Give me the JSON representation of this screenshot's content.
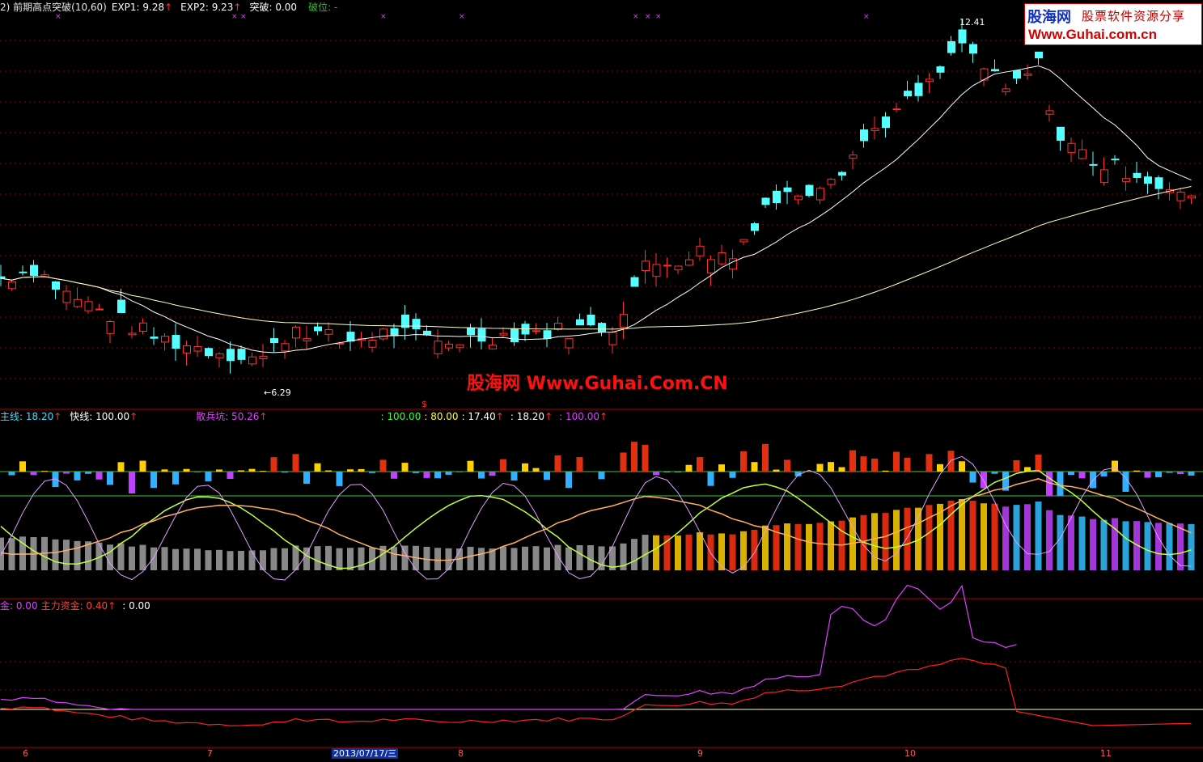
{
  "panel1": {
    "title_prefix": "2) 前期高点突破(10,60)",
    "exp1_label": "EXP1: 9.28",
    "exp2_label": "EXP2: 9.23",
    "breakout_label": "突破: 0.00",
    "break_level_label": "破位: -",
    "high_label": "12.41",
    "low_label": "6.29",
    "signal_marker": "$"
  },
  "panel2": {
    "main_line_label": "主线: 18.20",
    "fast_line_label": "快线: 100.00",
    "retail_pit_label": "散兵坑: 50.26",
    "v1": ": 100.00",
    "v2": ": 80.00",
    "v3": ": 17.40",
    "v4": ": 18.20",
    "v5": ": 100.00"
  },
  "panel3": {
    "gold_label": "金: 0.00",
    "main_fund_label": "主力资金: 0.40",
    "v1": ": 0.00"
  },
  "logo": {
    "name": "股海网",
    "slogan": "股票软件资源分享",
    "url": "Www.Guhai.com.cn"
  },
  "watermark": "股海网 Www.Guhai.Com.CN",
  "x_axis": {
    "months": [
      "6",
      "7",
      "8",
      "9",
      "10",
      "11"
    ],
    "cursor_date": "2013/07/17/三"
  },
  "colors": {
    "background": "#000000",
    "up_candle": "#ff3030",
    "down_candle": "#54ffff",
    "ma_short": "#ffffff",
    "ma_long": "#ffffc0",
    "grid": "#8b0000",
    "magenta_line": "#e040ff",
    "main_fund_line": "#ff2020"
  },
  "chart_data": {
    "type": "candlestick",
    "low_annotation": 6.29,
    "high_annotation": 12.41
  }
}
